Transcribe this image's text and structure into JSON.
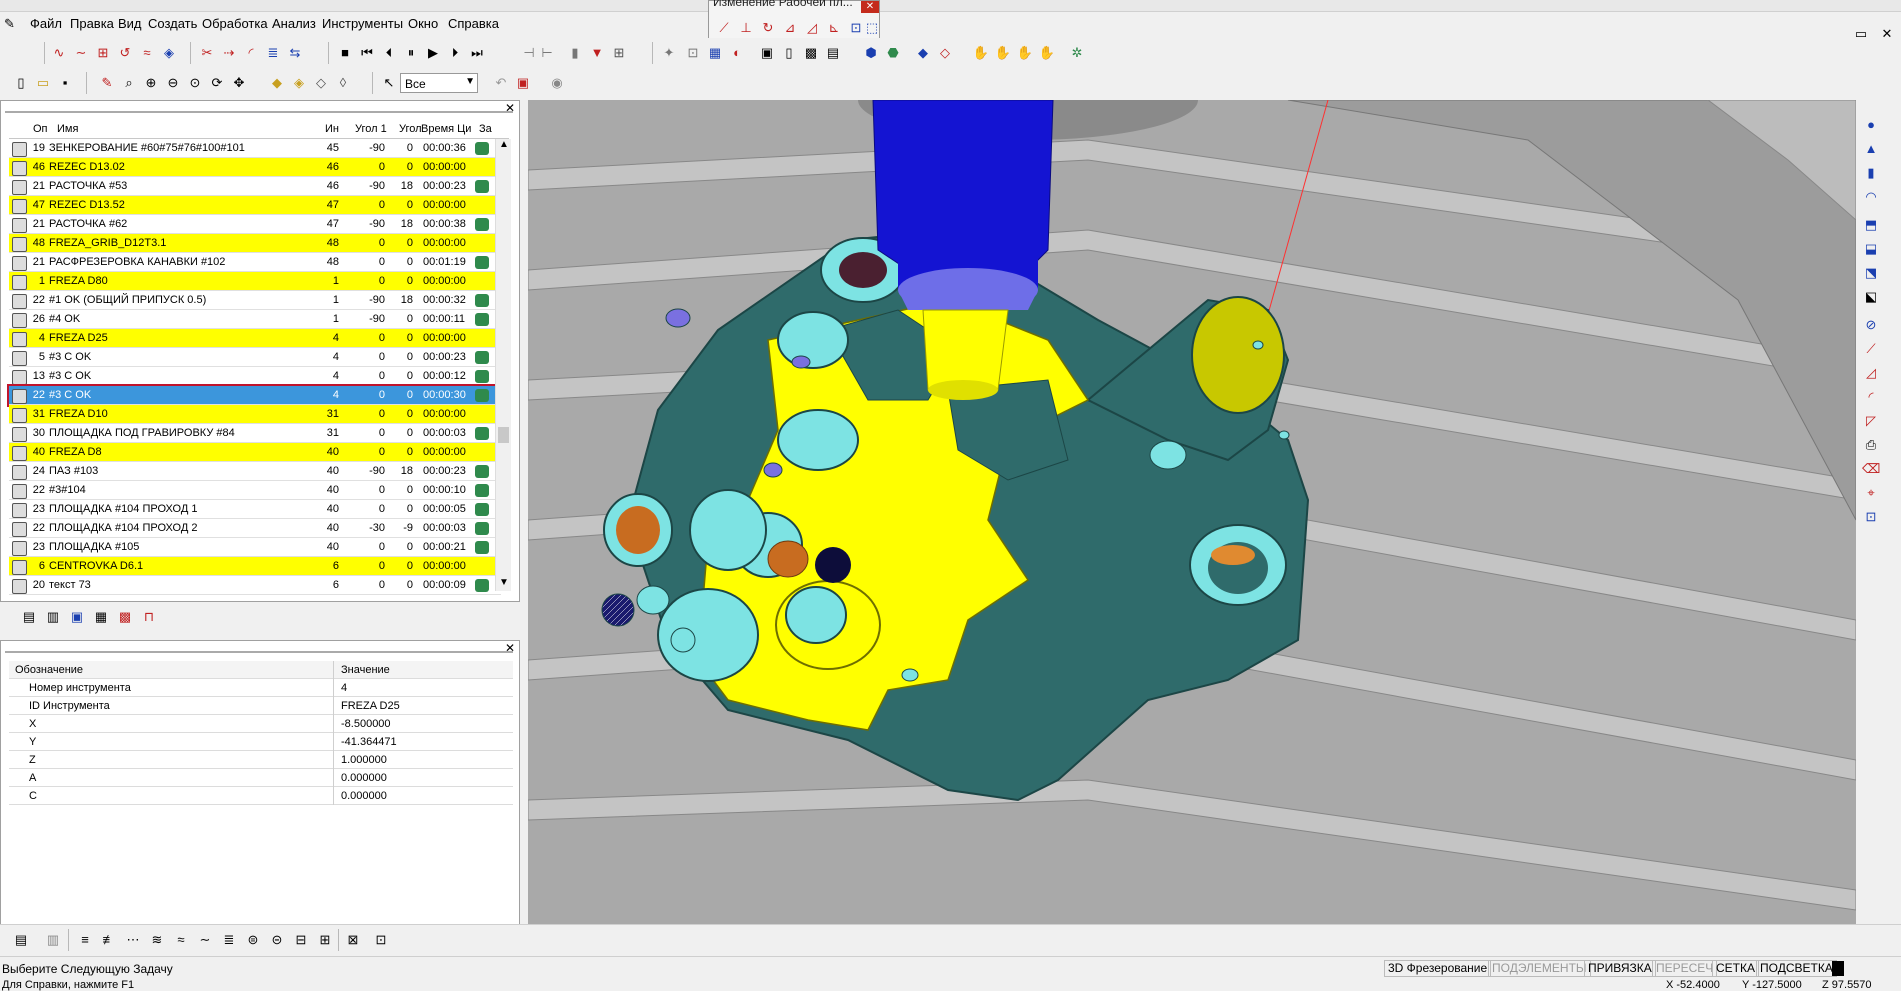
{
  "floating_toolbar": {
    "title": "Изменение Рабочей пл..."
  },
  "menu": [
    "Файл",
    "Правка",
    "Вид",
    "Создать",
    "Обработка",
    "Анализ",
    "Инструменты",
    "Окно",
    "Справка"
  ],
  "window_controls": [
    "_",
    "▭",
    "✕"
  ],
  "filter_select": {
    "value": "Все"
  },
  "operations": {
    "columns": [
      "Оп",
      "Имя",
      "Ин",
      "Угол 1",
      "Угол",
      "Время Ци",
      "За"
    ],
    "rows": [
      {
        "op": "19",
        "name": "ЗЕНКЕРОВАНИЕ #60#75#76#100#101",
        "tool": "45",
        "a1": "-90",
        "a2": "0",
        "time": "00:00:36",
        "kind": "op"
      },
      {
        "op": "46",
        "name": "REZEC D13.02",
        "tool": "46",
        "a1": "0",
        "a2": "0",
        "time": "00:00:00",
        "kind": "tool"
      },
      {
        "op": "21",
        "name": "РАСТОЧКА #53",
        "tool": "46",
        "a1": "-90",
        "a2": "18",
        "time": "00:00:23",
        "kind": "op"
      },
      {
        "op": "47",
        "name": "REZEC D13.52",
        "tool": "47",
        "a1": "0",
        "a2": "0",
        "time": "00:00:00",
        "kind": "tool"
      },
      {
        "op": "21",
        "name": "РАСТОЧКА #62",
        "tool": "47",
        "a1": "-90",
        "a2": "18",
        "time": "00:00:38",
        "kind": "op"
      },
      {
        "op": "48",
        "name": "FREZA_GRIB_D12T3.1",
        "tool": "48",
        "a1": "0",
        "a2": "0",
        "time": "00:00:00",
        "kind": "tool"
      },
      {
        "op": "21",
        "name": "РАСФРЕЗЕРОВКА КАНАВКИ #102",
        "tool": "48",
        "a1": "0",
        "a2": "0",
        "time": "00:01:19",
        "kind": "op"
      },
      {
        "op": "1",
        "name": "FREZA D80",
        "tool": "1",
        "a1": "0",
        "a2": "0",
        "time": "00:00:00",
        "kind": "tool"
      },
      {
        "op": "22",
        "name": "#1 OK (ОБЩИЙ ПРИПУСК 0.5)",
        "tool": "1",
        "a1": "-90",
        "a2": "18",
        "time": "00:00:32",
        "kind": "op"
      },
      {
        "op": "26",
        "name": "#4 OK",
        "tool": "1",
        "a1": "-90",
        "a2": "0",
        "time": "00:00:11",
        "kind": "op"
      },
      {
        "op": "4",
        "name": "FREZA D25",
        "tool": "4",
        "a1": "0",
        "a2": "0",
        "time": "00:00:00",
        "kind": "tool"
      },
      {
        "op": "5",
        "name": "#3 C OK",
        "tool": "4",
        "a1": "0",
        "a2": "0",
        "time": "00:00:23",
        "kind": "op"
      },
      {
        "op": "13",
        "name": "#3 C OK",
        "tool": "4",
        "a1": "0",
        "a2": "0",
        "time": "00:00:12",
        "kind": "op"
      },
      {
        "op": "22",
        "name": "#3 C OK",
        "tool": "4",
        "a1": "0",
        "a2": "0",
        "time": "00:00:30",
        "kind": "sel"
      },
      {
        "op": "31",
        "name": "FREZA D10",
        "tool": "31",
        "a1": "0",
        "a2": "0",
        "time": "00:00:00",
        "kind": "tool"
      },
      {
        "op": "30",
        "name": "ПЛОЩАДКА ПОД ГРАВИРОВКУ #84",
        "tool": "31",
        "a1": "0",
        "a2": "0",
        "time": "00:00:03",
        "kind": "op"
      },
      {
        "op": "40",
        "name": "FREZA D8",
        "tool": "40",
        "a1": "0",
        "a2": "0",
        "time": "00:00:00",
        "kind": "tool"
      },
      {
        "op": "24",
        "name": "ПАЗ #103",
        "tool": "40",
        "a1": "-90",
        "a2": "18",
        "time": "00:00:23",
        "kind": "op"
      },
      {
        "op": "22",
        "name": "#3#104",
        "tool": "40",
        "a1": "0",
        "a2": "0",
        "time": "00:00:10",
        "kind": "op"
      },
      {
        "op": "23",
        "name": "ПЛОЩАДКА #104 ПРОХОД 1",
        "tool": "40",
        "a1": "0",
        "a2": "0",
        "time": "00:00:05",
        "kind": "op"
      },
      {
        "op": "22",
        "name": "ПЛОЩАДКА #104 ПРОХОД 2",
        "tool": "40",
        "a1": "-30",
        "a2": "-9",
        "time": "00:00:03",
        "kind": "op"
      },
      {
        "op": "23",
        "name": "ПЛОЩАДКА #105",
        "tool": "40",
        "a1": "0",
        "a2": "0",
        "time": "00:00:21",
        "kind": "op"
      },
      {
        "op": "6",
        "name": "CENTROVKA D6.1",
        "tool": "6",
        "a1": "0",
        "a2": "0",
        "time": "00:00:00",
        "kind": "tool"
      },
      {
        "op": "20",
        "name": "текст 73",
        "tool": "6",
        "a1": "0",
        "a2": "0",
        "time": "00:00:09",
        "kind": "op"
      }
    ]
  },
  "properties": {
    "col_name": "Обозначение",
    "col_value": "Значение",
    "rows": [
      {
        "name": "Номер инструмента",
        "value": "4"
      },
      {
        "name": "ID Инструмента",
        "value": "FREZA D25"
      },
      {
        "name": "X",
        "value": "-8.500000"
      },
      {
        "name": "Y",
        "value": "-41.364471"
      },
      {
        "name": "Z",
        "value": "1.000000"
      },
      {
        "name": "A",
        "value": "0.000000"
      },
      {
        "name": "C",
        "value": "0.000000"
      }
    ]
  },
  "status": {
    "line1": "Выберите Следующую Задачу",
    "line2": "Для Справки, нажмите F1",
    "cells": [
      "3D Фрезерование",
      "ПОДЭЛЕМЕНТЫ",
      "ПРИВЯЗКА",
      "ПЕРЕСЕЧ",
      "СЕТКА",
      "ПОДСВЕТКА"
    ],
    "coords": [
      "X -52.4000",
      "Y -127.5000",
      "Z 97.5570"
    ]
  },
  "colors": {
    "part": "#2f6b6b",
    "machined": "#ffff00",
    "spindle": "#1414d2",
    "table": "#a8a8a8",
    "selection": "#3c96dc"
  }
}
